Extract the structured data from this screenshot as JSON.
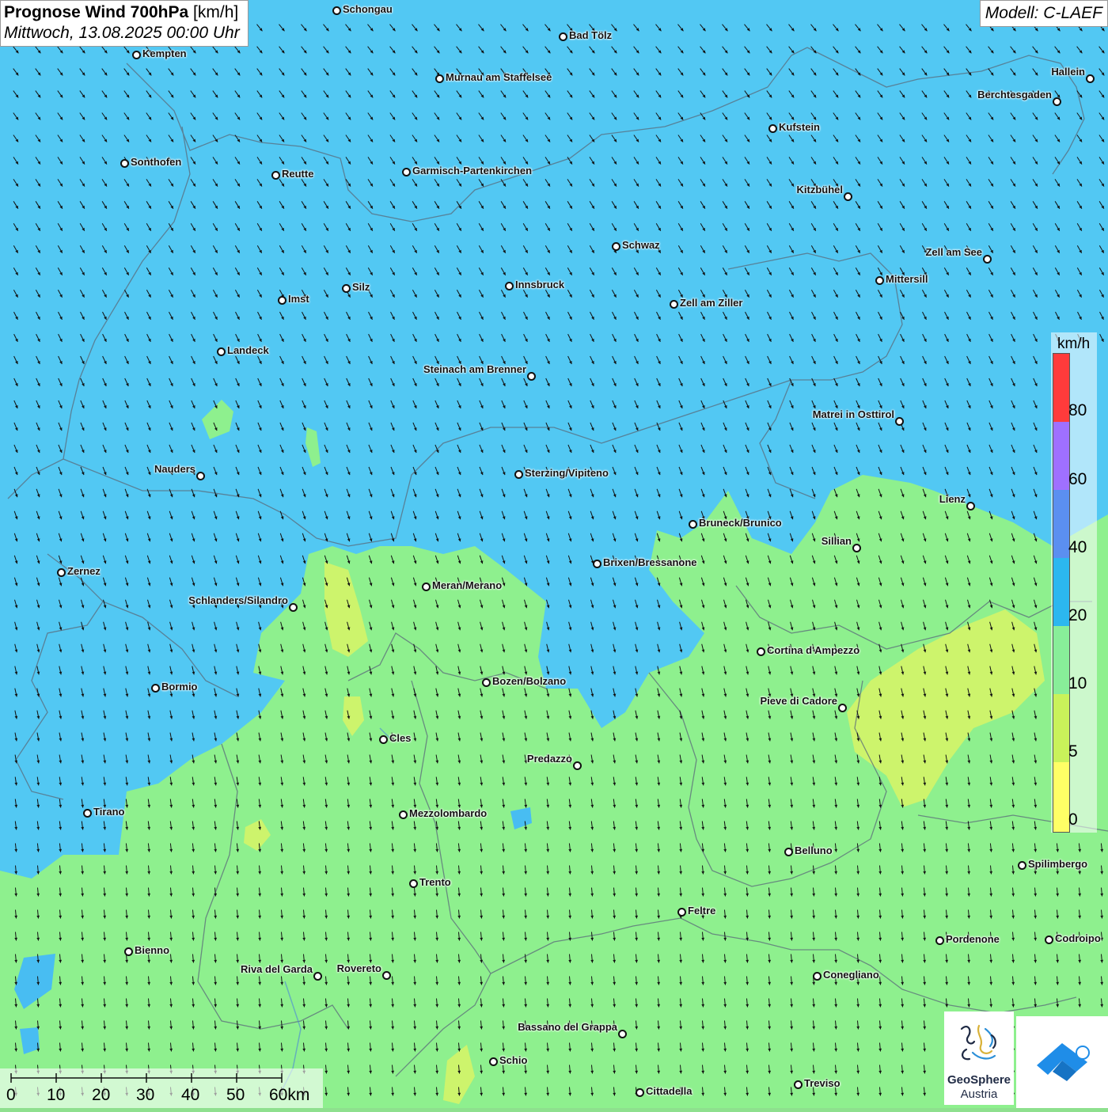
{
  "title": {
    "main": "Prognose Wind 700hPa",
    "unit": "[km/h]",
    "datetime": "Mittwoch, 13.08.2025 00:00 Uhr"
  },
  "model": "Modell: C-LAEF",
  "legend": {
    "unit": "km/h",
    "ticks": [
      "80",
      "60",
      "40",
      "20",
      "10",
      "5",
      "0"
    ],
    "colors": [
      "#ff3b3b",
      "#9f70ff",
      "#5b8ff0",
      "#2cb7ef",
      "#88ee99",
      "#c9f25a",
      "#ffff66"
    ]
  },
  "scale": {
    "labels": [
      "0",
      "10",
      "20",
      "30",
      "40",
      "50",
      "60km"
    ]
  },
  "colors": {
    "strong_wind": "#5ad2f5",
    "mid_wind": "#48bdf2",
    "weak_wind": "#8ef08e",
    "calm": "#d8f466",
    "arrow": "#111111"
  },
  "wind": {
    "direction": "from north-northwest",
    "speed_range_kmh": "5-25"
  },
  "logos": {
    "geosphere_line1": "GeoSphere",
    "geosphere_line2": "Austria"
  },
  "cities": [
    {
      "id": "schongau",
      "name": "Schongau"
    },
    {
      "id": "bad-toelz",
      "name": "Bad Tölz"
    },
    {
      "id": "kempten",
      "name": "Kempten"
    },
    {
      "id": "murnau",
      "name": "Murnau am Staffelsee"
    },
    {
      "id": "hallein",
      "name": "Hallein"
    },
    {
      "id": "berchtesgaden",
      "name": "Berchtesgaden"
    },
    {
      "id": "kufstein",
      "name": "Kufstein"
    },
    {
      "id": "sonthofen",
      "name": "Sonthofen"
    },
    {
      "id": "reutte",
      "name": "Reutte"
    },
    {
      "id": "garmisch",
      "name": "Garmisch-Partenkirchen"
    },
    {
      "id": "kitzbuehel",
      "name": "Kitzbühel"
    },
    {
      "id": "schwaz",
      "name": "Schwaz"
    },
    {
      "id": "zell-am-see",
      "name": "Zell am See"
    },
    {
      "id": "mittersill",
      "name": "Mittersill"
    },
    {
      "id": "innsbruck",
      "name": "Innsbruck"
    },
    {
      "id": "silz",
      "name": "Silz"
    },
    {
      "id": "imst",
      "name": "Imst"
    },
    {
      "id": "zell-am-ziller",
      "name": "Zell am Ziller"
    },
    {
      "id": "landeck",
      "name": "Landeck"
    },
    {
      "id": "steinach",
      "name": "Steinach am Brenner"
    },
    {
      "id": "matrei",
      "name": "Matrei in Osttirol"
    },
    {
      "id": "nauders",
      "name": "Nauders"
    },
    {
      "id": "sterzing",
      "name": "Sterzing/Vipiteno"
    },
    {
      "id": "lienz",
      "name": "Lienz"
    },
    {
      "id": "bruneck",
      "name": "Bruneck/Brunico"
    },
    {
      "id": "sillian",
      "name": "Sillian"
    },
    {
      "id": "brixen",
      "name": "Brixen/Bressanone"
    },
    {
      "id": "zernez",
      "name": "Zernez"
    },
    {
      "id": "meran",
      "name": "Meran/Merano"
    },
    {
      "id": "schlanders",
      "name": "Schlanders/Silandro"
    },
    {
      "id": "cortina",
      "name": "Cortina d'Ampezzo"
    },
    {
      "id": "bozen",
      "name": "Bozen/Bolzano"
    },
    {
      "id": "bormio",
      "name": "Bormio"
    },
    {
      "id": "pieve",
      "name": "Pieve di Cadore"
    },
    {
      "id": "cles",
      "name": "Cles"
    },
    {
      "id": "predazzo",
      "name": "Predazzo"
    },
    {
      "id": "tirano",
      "name": "Tirano"
    },
    {
      "id": "mezzolombardo",
      "name": "Mezzolombardo"
    },
    {
      "id": "belluno",
      "name": "Belluno"
    },
    {
      "id": "spilimbergo",
      "name": "Spilimbergo"
    },
    {
      "id": "trento",
      "name": "Trento"
    },
    {
      "id": "feltre",
      "name": "Feltre"
    },
    {
      "id": "pordenone",
      "name": "Pordenone"
    },
    {
      "id": "codroipo",
      "name": "Codroipo"
    },
    {
      "id": "bienno",
      "name": "Bienno"
    },
    {
      "id": "riva",
      "name": "Riva del Garda"
    },
    {
      "id": "rovereto",
      "name": "Rovereto"
    },
    {
      "id": "conegliano",
      "name": "Conegliano"
    },
    {
      "id": "bassano",
      "name": "Bassano del Grappa"
    },
    {
      "id": "schio",
      "name": "Schio"
    },
    {
      "id": "treviso",
      "name": "Treviso"
    },
    {
      "id": "cittadella",
      "name": "Cittadella"
    }
  ]
}
